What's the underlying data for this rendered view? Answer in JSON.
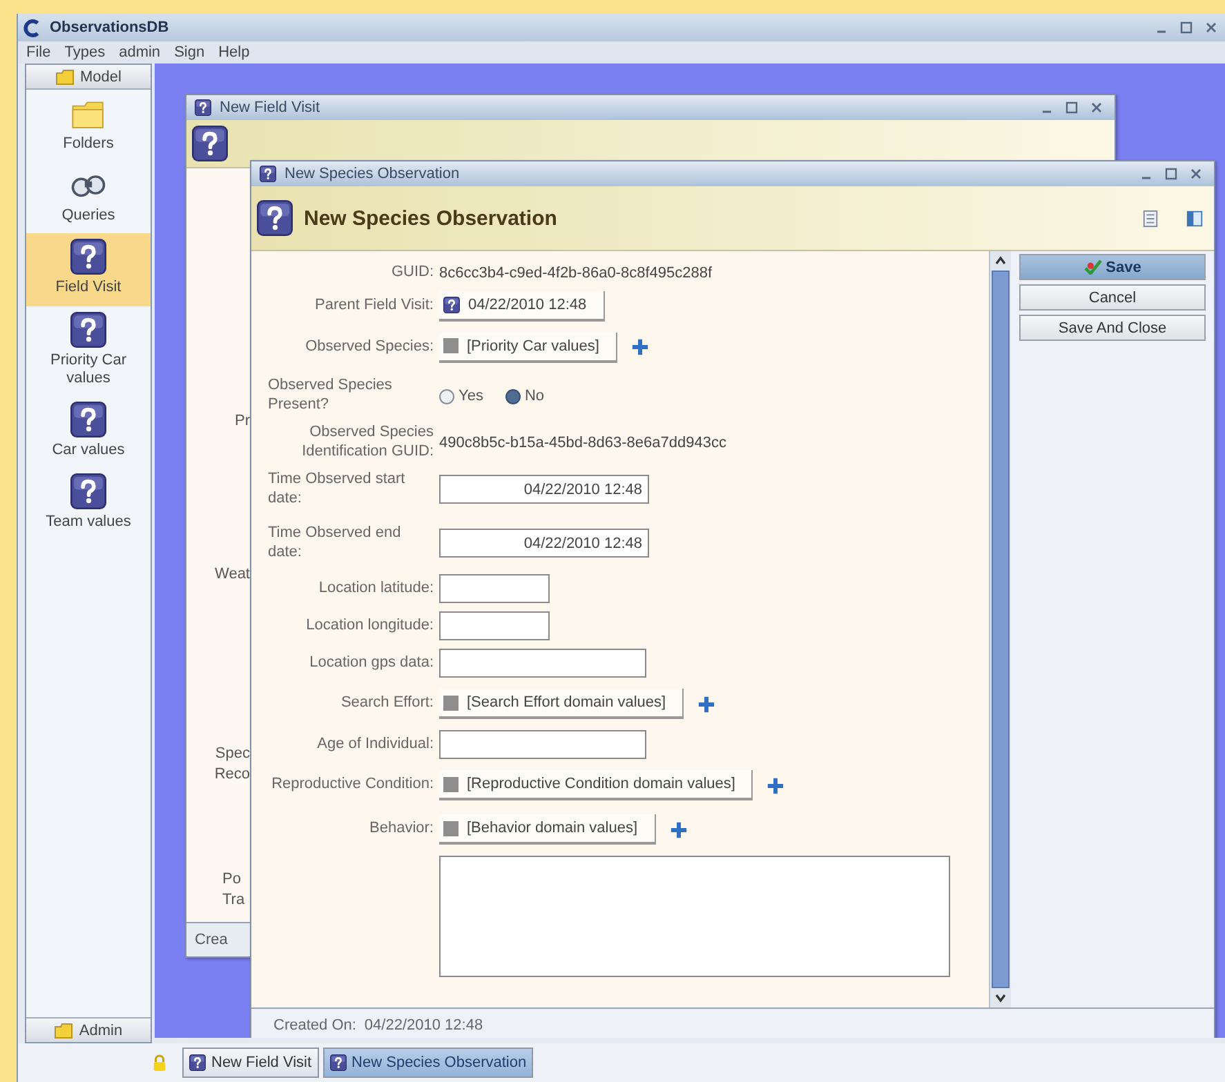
{
  "app": {
    "title": "ObservationsDB"
  },
  "menu": [
    "File",
    "Types",
    "admin",
    "Sign",
    "Help"
  ],
  "sidebar": {
    "header": "Model",
    "footer": "Admin",
    "items": [
      {
        "label": "Folders",
        "kind": "folder",
        "selected": false
      },
      {
        "label": "Queries",
        "kind": "query",
        "selected": false
      },
      {
        "label": "Field Visit",
        "kind": "form",
        "selected": true
      },
      {
        "label": "Priority Car values",
        "kind": "form",
        "selected": false
      },
      {
        "label": "Car values",
        "kind": "form",
        "selected": false
      },
      {
        "label": "Team values",
        "kind": "form",
        "selected": false
      }
    ]
  },
  "field_visit_window": {
    "title": "New Field Visit",
    "cut_labels": [
      "Pr",
      "Weat",
      "Spec Reco",
      "Po Tra"
    ],
    "footer": "Crea"
  },
  "species_window": {
    "title": "New Species Observation",
    "heading": "New Species Observation",
    "fields": [
      {
        "kind": "text",
        "label": "GUID:",
        "value": "8c6cc3b4-c9ed-4f2b-86a0-8c8f495c288f"
      },
      {
        "kind": "link",
        "label": "Parent Field Visit:",
        "value": "04/22/2010 12:48"
      },
      {
        "kind": "lookup",
        "label": "Observed Species:",
        "value": "[Priority Car values]"
      },
      {
        "kind": "radio",
        "label": "Observed Species Present?",
        "options": [
          {
            "label": "Yes",
            "selected": false
          },
          {
            "label": "No",
            "selected": true
          }
        ]
      },
      {
        "kind": "text",
        "label": "Observed Species Identification GUID:",
        "value": "490c8b5c-b15a-45bd-8d63-8e6a7dd943cc"
      },
      {
        "kind": "date",
        "label": "Time Observed start date:",
        "value": "04/22/2010 12:48"
      },
      {
        "kind": "date",
        "label": "Time Observed end date:",
        "value": "04/22/2010 12:48"
      },
      {
        "kind": "short-input",
        "label": "Location latitude:"
      },
      {
        "kind": "short-input",
        "label": "Location longitude:"
      },
      {
        "kind": "input",
        "label": "Location gps data:"
      },
      {
        "kind": "lookup",
        "label": "Search Effort:",
        "value": "[Search Effort domain values]"
      },
      {
        "kind": "input",
        "label": "Age of Individual:"
      },
      {
        "kind": "lookup",
        "label": "Reproductive Condition:",
        "value": "[Reproductive Condition domain values]"
      },
      {
        "kind": "lookup",
        "label": "Behavior:",
        "value": "[Behavior domain values]"
      },
      {
        "kind": "textarea"
      }
    ],
    "buttons": [
      {
        "label": "Save",
        "primary": true
      },
      {
        "label": "Cancel",
        "primary": false
      },
      {
        "label": "Save And Close",
        "primary": false
      }
    ],
    "footer_label": "Created On:",
    "footer_value": "04/22/2010 12:48"
  },
  "taskbar": [
    {
      "label": "New Field Visit",
      "selected": false
    },
    {
      "label": "New Species Observation",
      "selected": true
    }
  ]
}
